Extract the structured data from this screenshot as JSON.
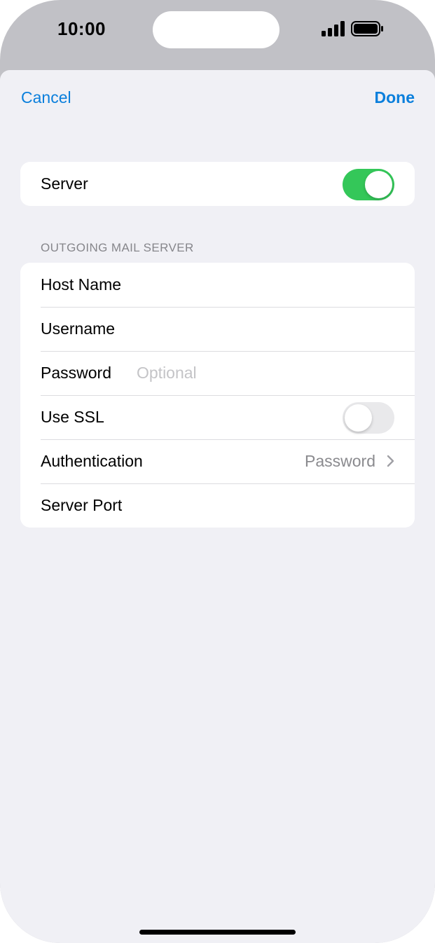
{
  "status_bar": {
    "time": "10:00"
  },
  "nav": {
    "cancel_label": "Cancel",
    "done_label": "Done"
  },
  "server_row": {
    "label": "Server",
    "toggle_on": true
  },
  "outgoing": {
    "section_title": "OUTGOING MAIL SERVER",
    "host_label": "Host Name",
    "username_label": "Username",
    "password_label": "Password",
    "password_placeholder": "Optional",
    "ssl_label": "Use SSL",
    "ssl_on": false,
    "auth_label": "Authentication",
    "auth_value": "Password",
    "port_label": "Server Port"
  },
  "colors": {
    "accent": "#0a7fdc",
    "toggle_on": "#34c759",
    "background": "#f0f0f5"
  }
}
